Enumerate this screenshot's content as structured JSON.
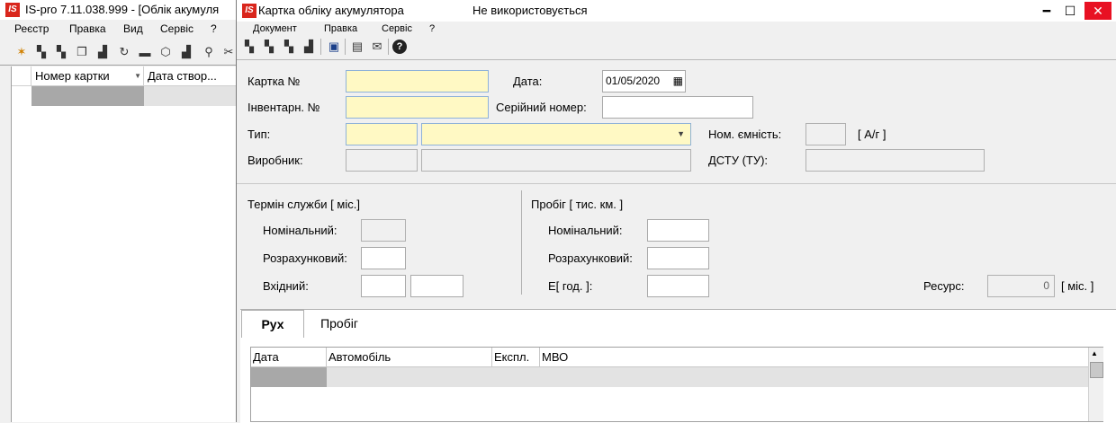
{
  "back_window": {
    "logo": "IS",
    "title": "IS-pro 7.11.038.999 - [Облік акумуля",
    "menu": [
      "Реєстр",
      "Правка",
      "Вид",
      "Сервіс",
      "?"
    ],
    "toolbar_icons": [
      "new-icon",
      "arrow-icon",
      "arrow-icon",
      "copy-icon",
      "arrow-icon",
      "refresh-icon",
      "printer-icon",
      "box-icon",
      "arrow-icon",
      "key-icon",
      "tools-icon"
    ],
    "columns": [
      "Номер картки",
      "Дата створ..."
    ]
  },
  "window": {
    "logo": "IS",
    "title": "Картка обліку акумулятора",
    "status": "Не використовується",
    "controls": {
      "minimize": "━",
      "maximize": "☐",
      "close": "✕"
    }
  },
  "menu": [
    "Документ",
    "Правка",
    "Сервіс",
    "?"
  ],
  "toolbar_icons": [
    "arrow-icon",
    "arrow-icon",
    "arrow-icon",
    "arrow-icon",
    "save-icon",
    "page-icon",
    "mail-icon",
    "help-icon"
  ],
  "form": {
    "card_no_label": "Картка №",
    "card_no_value": "",
    "date_label": "Дата:",
    "date_value": "01/05/2020",
    "inventory_label": "Інвентарн. №",
    "inventory_value": "",
    "serial_label": "Серійний номер:",
    "serial_value": "",
    "type_label": "Тип:",
    "type_code": "",
    "type_name": "",
    "capacity_label": "Ном. ємність:",
    "capacity_value": "",
    "capacity_unit": "[ А/г ]",
    "maker_label": "Виробник:",
    "maker_code": "",
    "maker_name": "",
    "dstu_label": "ДСТУ (ТУ):",
    "dstu_value": ""
  },
  "service": {
    "title": "Термін служби [ міс.]",
    "nominal_label": "Номінальний:",
    "nominal_value": "",
    "calc_label": "Розрахунковий:",
    "calc_value": "",
    "input_label": "Вхідний:",
    "input_value1": "",
    "input_value2": ""
  },
  "mileage": {
    "title": "Пробіг [ тис. км. ]",
    "nominal_label": "Номінальний:",
    "nominal_value": "",
    "calc_label": "Розрахунковий:",
    "calc_value": "",
    "e_label": "Е[ год. ]:",
    "e_value": ""
  },
  "resource": {
    "label": "Ресурс:",
    "value": "0",
    "unit": "[ міс. ]"
  },
  "tabs": [
    "Рух",
    "Пробіг"
  ],
  "grid": {
    "columns": [
      "Дата",
      "Автомобіль",
      "Експл.",
      "МВО"
    ]
  }
}
